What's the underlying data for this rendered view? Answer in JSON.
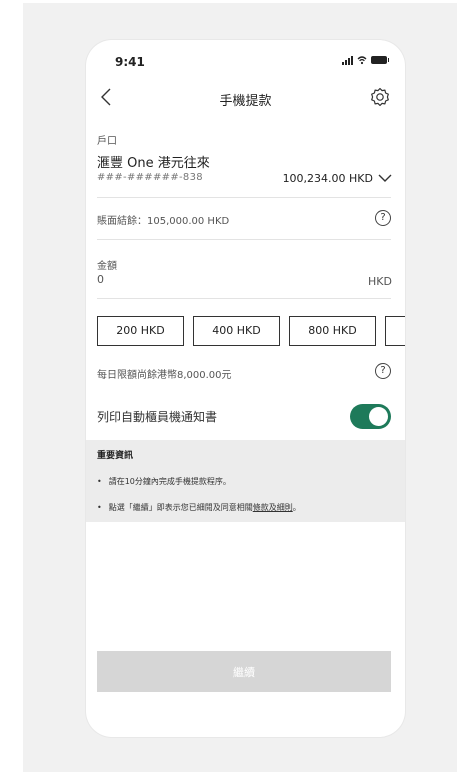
{
  "status_bar": {
    "time": "9:41"
  },
  "nav": {
    "title": "手機提款",
    "back_icon": "chevron-left-icon",
    "settings_icon": "gear-icon"
  },
  "account": {
    "label": "戶口",
    "name": "滙豐 One 港元往來",
    "number": "###-######-838",
    "balance": "100,234.00 HKD"
  },
  "ledger_balance": "賬面結餘：105,000.00 HKD",
  "amount": {
    "label": "金額",
    "value": "0",
    "currency": "HKD"
  },
  "quick_amounts": [
    "200 HKD",
    "400 HKD",
    "800 HKD"
  ],
  "daily_limit": "每日限額尚餘港幣8,000.00元",
  "print_notice": {
    "label": "列印自動櫃員機通知書",
    "enabled": true
  },
  "important_info": {
    "title": "重要資訊",
    "item1": "請在10分鐘內完成手機提款程序。",
    "item2_prefix": "點選「繼續」即表示您已細閱及同意相關",
    "item2_link": "條款及細則",
    "item2_suffix": "。"
  },
  "continue_label": "繼續",
  "colors": {
    "toggle_on": "#1e7a5a",
    "button_disabled": "#d6d6d6",
    "info_background": "#ececec",
    "page_background": "#f1f1f1"
  }
}
